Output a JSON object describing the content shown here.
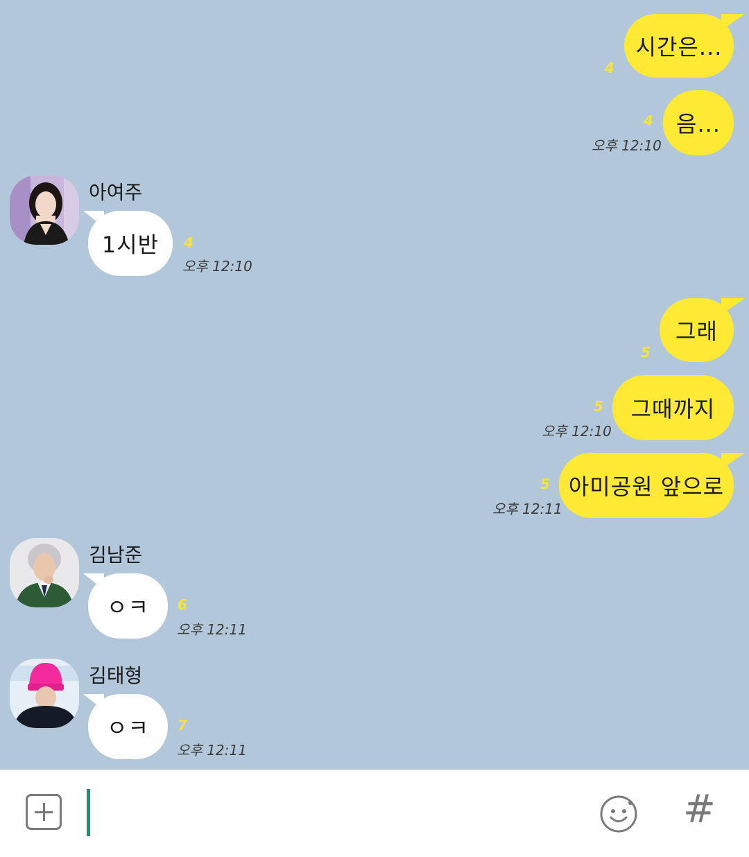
{
  "messages": [
    {
      "sender": "me",
      "text": "시간은...",
      "unread": "4",
      "time": ""
    },
    {
      "sender": "me",
      "text": "음...",
      "unread": "4",
      "time": "오후 12:10"
    },
    {
      "sender": "아여주",
      "text": "1시반",
      "unread": "4",
      "time": "오후 12:10"
    },
    {
      "sender": "me",
      "text": "그래",
      "unread": "5",
      "time": ""
    },
    {
      "sender": "me",
      "text": "그때까지",
      "unread": "5",
      "time": "오후 12:10"
    },
    {
      "sender": "me",
      "text": "아미공원 앞으로",
      "unread": "5",
      "time": "오후 12:11"
    },
    {
      "sender": "김남준",
      "text": "ㅇㅋ",
      "unread": "6",
      "time": "오후 12:11"
    },
    {
      "sender": "김태형",
      "text": "ㅇㅋ",
      "unread": "7",
      "time": "오후 12:11"
    }
  ],
  "input": {
    "value": ""
  },
  "icons": {
    "attach": "plus-icon",
    "emoji": "emoji-icon",
    "hashtag": "hashtag-icon"
  },
  "hashtag_glyph": "#",
  "colors": {
    "background": "#b2c7da",
    "my_bubble": "#fee934",
    "other_bubble": "#ffffff",
    "unread": "#f7e33c",
    "caret": "#1e8f7c"
  }
}
